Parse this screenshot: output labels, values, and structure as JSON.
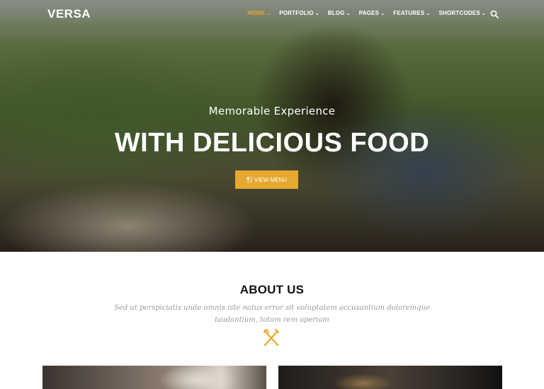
{
  "nav": {
    "logo": "VERSA",
    "items": [
      {
        "label": "HOME",
        "active": true
      },
      {
        "label": "PORTFOLIO"
      },
      {
        "label": "BLOG"
      },
      {
        "label": "PAGES"
      },
      {
        "label": "FEATURES"
      },
      {
        "label": "SHORTCODES"
      }
    ],
    "search_icon": "search-icon"
  },
  "hero": {
    "subtitle": "Memorable Experience",
    "title": "WITH DELICIOUS FOOD",
    "button": {
      "label": "VIEW MENU",
      "icon": "utensils-icon"
    }
  },
  "about": {
    "title": "ABOUT US",
    "text": "Sed ut perspiciatis unde omnis iste natus error sit voluptatem accusantium doloremque laudantium, totam rem aperiam",
    "icon": "fork-knife-icon"
  },
  "colors": {
    "accent": "#e6a82e",
    "heading": "#111111",
    "muted_text": "#9a9a9a"
  }
}
